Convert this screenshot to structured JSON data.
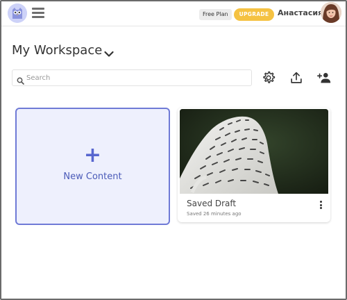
{
  "header": {
    "plan_label": "Free Plan",
    "upgrade_label": "UPGRADE",
    "user_name": "Анастасия",
    "logo_icon": "owl-logo-icon",
    "menu_icon": "hamburger-menu-icon",
    "accent_color": "#f5c242"
  },
  "workspace": {
    "title": "My Workspace",
    "dropdown_icon": "chevron-down-icon"
  },
  "search": {
    "placeholder": "Search",
    "value": ""
  },
  "toolbar": {
    "icons": [
      "gear-icon",
      "upload-icon",
      "add-person-icon"
    ]
  },
  "cards": {
    "new_content": {
      "icon": "plus-icon",
      "label": "New Content",
      "accent_color": "#6f7ad6"
    },
    "draft": {
      "title": "Saved Draft",
      "subtitle": "Saved 26 minutes ago",
      "menu_icon": "kebab-menu-icon"
    }
  }
}
